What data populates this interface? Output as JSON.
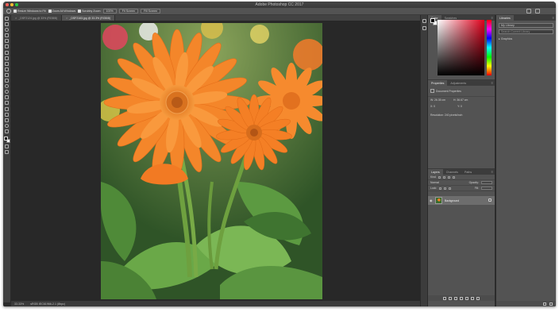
{
  "window": {
    "title": "Adobe Photoshop CC 2017"
  },
  "options_bar": {
    "buttons": [
      "Resize Windows to Fit",
      "Zoom All Windows",
      "Scrubby Zoom",
      "100%",
      "Fit Screen",
      "Fill Screen"
    ]
  },
  "tabs": [
    {
      "label": "_DSF2124.jpg @ 33% (RGB/8)"
    },
    {
      "label": "_DSF2163.jpg @ 33.3% (RGB/8)"
    }
  ],
  "status": {
    "zoom": "33.33%",
    "info": "sRGB IEC61966-2.1 (8bpc)"
  },
  "color_panel": {
    "tabs": [
      "Color",
      "Swatches"
    ],
    "hue_color": "#e0001b"
  },
  "properties_panel": {
    "tabs": [
      "Properties",
      "Adjustments"
    ],
    "header": "Document Properties",
    "w_label": "W:",
    "w_value": "26.35 cm",
    "h_label": "H:",
    "h_value": "36.67 cm",
    "x_label": "X:",
    "x_value": "0",
    "y_label": "Y:",
    "y_value": "0",
    "resolution": "Resolution: 240 pixels/inch"
  },
  "layers_panel": {
    "tabs": [
      "Layers",
      "Channels",
      "Paths"
    ],
    "kind": "Kind",
    "blend": "Normal",
    "opacity_label": "Opacity:",
    "lock_label": "Lock:",
    "fill_label": "Fill:",
    "layer_name": "Background"
  },
  "libraries_panel": {
    "tabs": [
      "Libraries"
    ],
    "library": "My Library",
    "search_placeholder": "Search Current Library",
    "group": "Graphics"
  }
}
